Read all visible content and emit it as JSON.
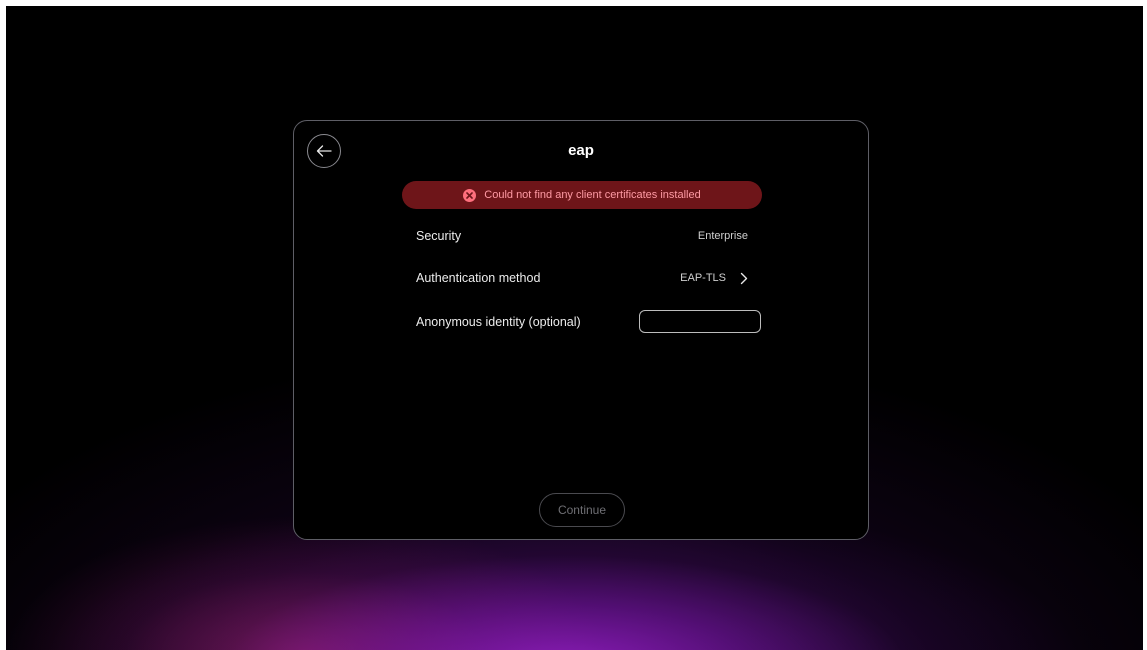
{
  "dialog": {
    "title": "eap",
    "error_message": "Could not find any client certificates installed"
  },
  "icons": {
    "back": "arrow-left-icon",
    "error": "error-x-circle-icon",
    "chevron": "chevron-right-icon"
  },
  "settings": {
    "security": {
      "label": "Security",
      "value": "Enterprise"
    },
    "auth_method": {
      "label": "Authentication method",
      "value": "EAP-TLS"
    },
    "anonymous_identity": {
      "label": "Anonymous identity (optional)",
      "value": "",
      "placeholder": ""
    }
  },
  "actions": {
    "continue_label": "Continue",
    "continue_enabled": false
  },
  "colors": {
    "error_banner_bg": "#6e1519",
    "error_text": "#ff9aa4",
    "error_icon": "#ff6f7d",
    "background_glow": "#9a1ec8"
  }
}
